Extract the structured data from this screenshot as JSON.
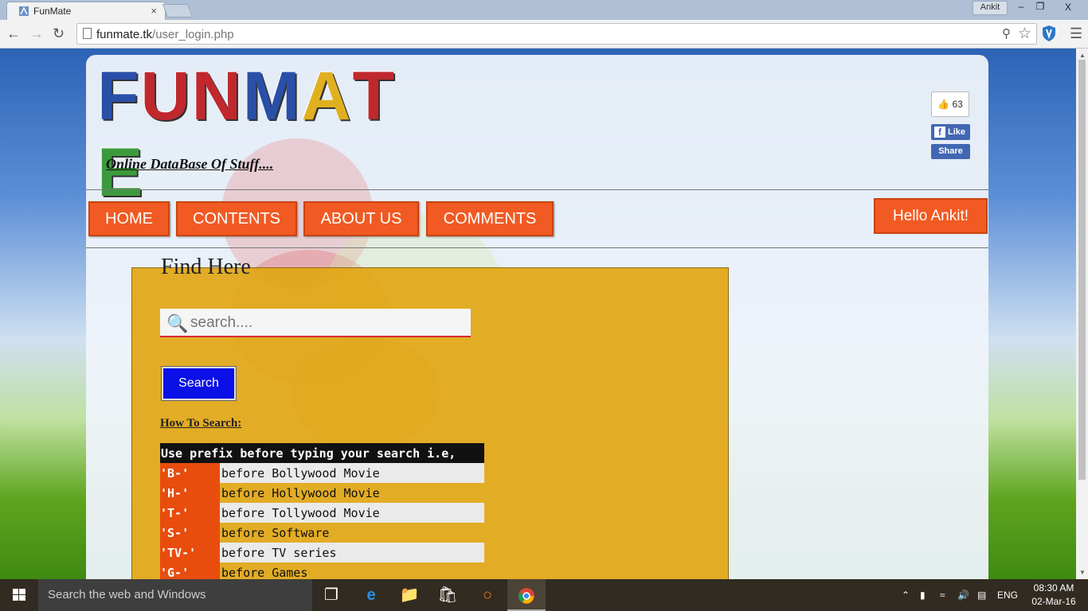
{
  "browser": {
    "tab_title": "FunMate",
    "tab_close": "×",
    "profile_name": "Ankit",
    "url_host": "funmate.tk",
    "url_path": "/user_login.php",
    "window_minimize": "–",
    "window_restore": "❐",
    "window_close": "X"
  },
  "site": {
    "logo_letters": [
      "F",
      "U",
      "N",
      "M",
      "A",
      "T",
      "E"
    ],
    "logo_colors": [
      "#2a4fa8",
      "#c0282e",
      "#c0282e",
      "#2a4fa8",
      "#e0b020",
      "#c0282e",
      "#3c9a3c"
    ],
    "tagline": "Online DataBase Of Stuff....",
    "fb_count": "63",
    "fb_like": "Like",
    "fb_share": "Share"
  },
  "nav": {
    "items": [
      {
        "label": "HOME"
      },
      {
        "label": "CONTENTS"
      },
      {
        "label": "ABOUT US"
      },
      {
        "label": "COMMENTS"
      }
    ],
    "greeting": "Hello Ankit!"
  },
  "find": {
    "title": "Find Here",
    "search_placeholder": "search....",
    "search_button": "Search",
    "howto_label": "How To Search:",
    "table_header": "Use prefix before typing your search i.e,",
    "prefixes": [
      {
        "code": "'B-'",
        "desc": "before Bollywood Movie"
      },
      {
        "code": "'H-'",
        "desc": "before Hollywood Movie"
      },
      {
        "code": "'T-'",
        "desc": "before Tollywood Movie"
      },
      {
        "code": "'S-'",
        "desc": "before Software"
      },
      {
        "code": "'TV-'",
        "desc": "before TV series"
      },
      {
        "code": "'G-'",
        "desc": "before Games"
      }
    ]
  },
  "taskbar": {
    "search_placeholder": "Search the web and Windows",
    "language": "ENG",
    "time": "08:30 AM",
    "date": "02-Mar-16"
  }
}
